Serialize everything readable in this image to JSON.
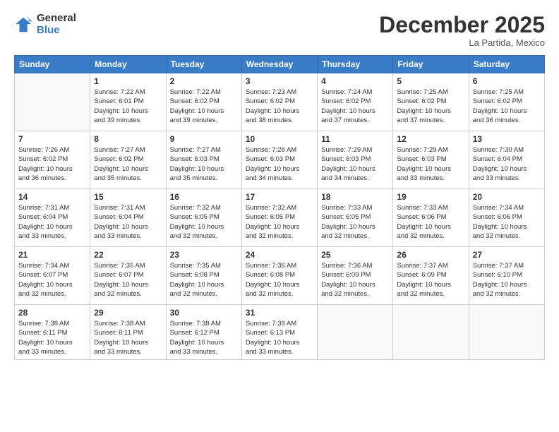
{
  "logo": {
    "general": "General",
    "blue": "Blue"
  },
  "header": {
    "month": "December 2025",
    "location": "La Partida, Mexico"
  },
  "weekdays": [
    "Sunday",
    "Monday",
    "Tuesday",
    "Wednesday",
    "Thursday",
    "Friday",
    "Saturday"
  ],
  "weeks": [
    [
      {
        "day": "",
        "info": ""
      },
      {
        "day": "1",
        "info": "Sunrise: 7:22 AM\nSunset: 6:01 PM\nDaylight: 10 hours\nand 39 minutes."
      },
      {
        "day": "2",
        "info": "Sunrise: 7:22 AM\nSunset: 6:02 PM\nDaylight: 10 hours\nand 39 minutes."
      },
      {
        "day": "3",
        "info": "Sunrise: 7:23 AM\nSunset: 6:02 PM\nDaylight: 10 hours\nand 38 minutes."
      },
      {
        "day": "4",
        "info": "Sunrise: 7:24 AM\nSunset: 6:02 PM\nDaylight: 10 hours\nand 37 minutes."
      },
      {
        "day": "5",
        "info": "Sunrise: 7:25 AM\nSunset: 6:02 PM\nDaylight: 10 hours\nand 37 minutes."
      },
      {
        "day": "6",
        "info": "Sunrise: 7:25 AM\nSunset: 6:02 PM\nDaylight: 10 hours\nand 36 minutes."
      }
    ],
    [
      {
        "day": "7",
        "info": "Sunrise: 7:26 AM\nSunset: 6:02 PM\nDaylight: 10 hours\nand 36 minutes."
      },
      {
        "day": "8",
        "info": "Sunrise: 7:27 AM\nSunset: 6:02 PM\nDaylight: 10 hours\nand 35 minutes."
      },
      {
        "day": "9",
        "info": "Sunrise: 7:27 AM\nSunset: 6:03 PM\nDaylight: 10 hours\nand 35 minutes."
      },
      {
        "day": "10",
        "info": "Sunrise: 7:28 AM\nSunset: 6:03 PM\nDaylight: 10 hours\nand 34 minutes."
      },
      {
        "day": "11",
        "info": "Sunrise: 7:29 AM\nSunset: 6:03 PM\nDaylight: 10 hours\nand 34 minutes."
      },
      {
        "day": "12",
        "info": "Sunrise: 7:29 AM\nSunset: 6:03 PM\nDaylight: 10 hours\nand 33 minutes."
      },
      {
        "day": "13",
        "info": "Sunrise: 7:30 AM\nSunset: 6:04 PM\nDaylight: 10 hours\nand 33 minutes."
      }
    ],
    [
      {
        "day": "14",
        "info": "Sunrise: 7:31 AM\nSunset: 6:04 PM\nDaylight: 10 hours\nand 33 minutes."
      },
      {
        "day": "15",
        "info": "Sunrise: 7:31 AM\nSunset: 6:04 PM\nDaylight: 10 hours\nand 33 minutes."
      },
      {
        "day": "16",
        "info": "Sunrise: 7:32 AM\nSunset: 6:05 PM\nDaylight: 10 hours\nand 32 minutes."
      },
      {
        "day": "17",
        "info": "Sunrise: 7:32 AM\nSunset: 6:05 PM\nDaylight: 10 hours\nand 32 minutes."
      },
      {
        "day": "18",
        "info": "Sunrise: 7:33 AM\nSunset: 6:05 PM\nDaylight: 10 hours\nand 32 minutes."
      },
      {
        "day": "19",
        "info": "Sunrise: 7:33 AM\nSunset: 6:06 PM\nDaylight: 10 hours\nand 32 minutes."
      },
      {
        "day": "20",
        "info": "Sunrise: 7:34 AM\nSunset: 6:06 PM\nDaylight: 10 hours\nand 32 minutes."
      }
    ],
    [
      {
        "day": "21",
        "info": "Sunrise: 7:34 AM\nSunset: 6:07 PM\nDaylight: 10 hours\nand 32 minutes."
      },
      {
        "day": "22",
        "info": "Sunrise: 7:35 AM\nSunset: 6:07 PM\nDaylight: 10 hours\nand 32 minutes."
      },
      {
        "day": "23",
        "info": "Sunrise: 7:35 AM\nSunset: 6:08 PM\nDaylight: 10 hours\nand 32 minutes."
      },
      {
        "day": "24",
        "info": "Sunrise: 7:36 AM\nSunset: 6:08 PM\nDaylight: 10 hours\nand 32 minutes."
      },
      {
        "day": "25",
        "info": "Sunrise: 7:36 AM\nSunset: 6:09 PM\nDaylight: 10 hours\nand 32 minutes."
      },
      {
        "day": "26",
        "info": "Sunrise: 7:37 AM\nSunset: 6:09 PM\nDaylight: 10 hours\nand 32 minutes."
      },
      {
        "day": "27",
        "info": "Sunrise: 7:37 AM\nSunset: 6:10 PM\nDaylight: 10 hours\nand 32 minutes."
      }
    ],
    [
      {
        "day": "28",
        "info": "Sunrise: 7:38 AM\nSunset: 6:11 PM\nDaylight: 10 hours\nand 33 minutes."
      },
      {
        "day": "29",
        "info": "Sunrise: 7:38 AM\nSunset: 6:11 PM\nDaylight: 10 hours\nand 33 minutes."
      },
      {
        "day": "30",
        "info": "Sunrise: 7:38 AM\nSunset: 6:12 PM\nDaylight: 10 hours\nand 33 minutes."
      },
      {
        "day": "31",
        "info": "Sunrise: 7:39 AM\nSunset: 6:13 PM\nDaylight: 10 hours\nand 33 minutes."
      },
      {
        "day": "",
        "info": ""
      },
      {
        "day": "",
        "info": ""
      },
      {
        "day": "",
        "info": ""
      }
    ]
  ]
}
